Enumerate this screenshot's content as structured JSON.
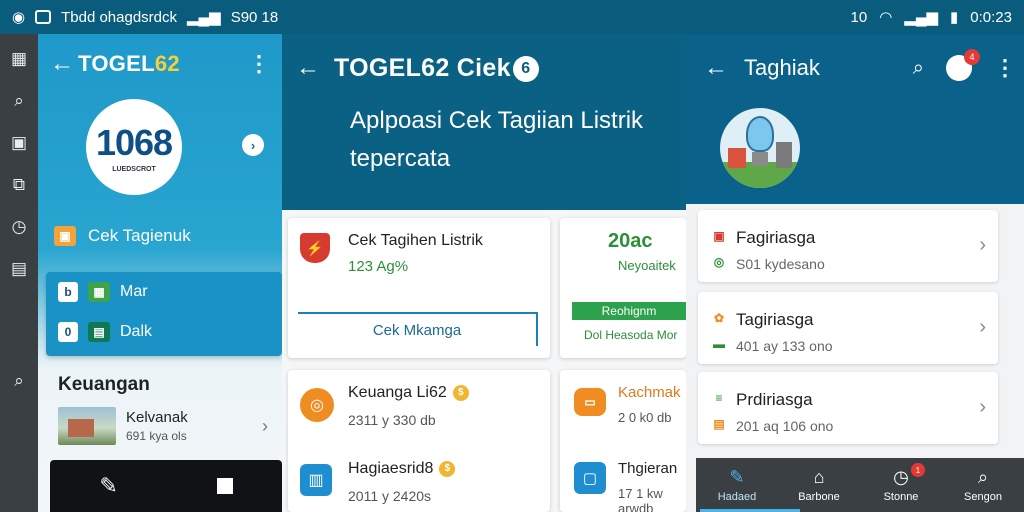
{
  "statusbar": {
    "left_text": "Tbdd ohagdsrdck",
    "signal_text": "S90 18",
    "right_badge": "10",
    "time": "0:0:23"
  },
  "rail": {
    "icons": [
      "grid-icon",
      "search-icon",
      "image-icon",
      "external-icon",
      "clock-icon",
      "apps-icon",
      "search-icon"
    ]
  },
  "panel1": {
    "title_main": "TOGEL",
    "title_num": "62",
    "logo_num": "1068",
    "logo_sub": "LUEDSCROT",
    "menu_item": "Cek Tagienuk",
    "box": [
      {
        "badge": "b",
        "label": "Mar"
      },
      {
        "badge": "0",
        "label": "Dalk"
      }
    ],
    "section": "Keuangan",
    "item_title": "Kelvanak",
    "item_sub": "691 kya ols",
    "colors": {
      "accent": "#1a92c6",
      "yellow": "#f4d03f"
    }
  },
  "panel2": {
    "title": "TOGEL62 Ciek",
    "title_badge": "6",
    "headline": "Aplpoasi Cek Tagiian Listrik tepercata",
    "card_a": {
      "title": "Cek Tagihen Listrik",
      "value": "123 Ag%",
      "button": "Cek Mkamga"
    },
    "card_b": {
      "big": "20ac",
      "mid": "Neyoaitek",
      "bar": "Reohignm",
      "small": "Dol Heasoda Mor"
    },
    "card_c": {
      "title1": "Keuanga Li62",
      "sub1": "2311 y 330 db",
      "title2": "Hagiaesrid8",
      "sub2": "2011 y 2420s"
    },
    "card_d": {
      "title1": "Kachmak",
      "sub1": "2 0 k0 db",
      "title2": "Thgieran",
      "sub2": "17 1 kw arwdb"
    },
    "colors": {
      "green": "#2d8f3a",
      "orange": "#ef8d22",
      "blue": "#1f8ed0",
      "red": "#d63b2f"
    }
  },
  "panel3": {
    "title": "Taghiak",
    "notif_badge": "4",
    "rows": [
      {
        "title": "Fagiriasga",
        "sub": "S01 kydesano"
      },
      {
        "title": "Tagiriasga",
        "sub": "401 ay 133 ono"
      },
      {
        "title": "Prdiriasga",
        "sub": "201 aq 106 ono"
      }
    ],
    "nav": [
      {
        "label": "Hadaed",
        "icon": "pen-icon"
      },
      {
        "label": "Barbone",
        "icon": "home-icon"
      },
      {
        "label": "Stonne",
        "icon": "timer-icon",
        "badge": "1"
      },
      {
        "label": "Sengon",
        "icon": "search-icon"
      }
    ]
  }
}
